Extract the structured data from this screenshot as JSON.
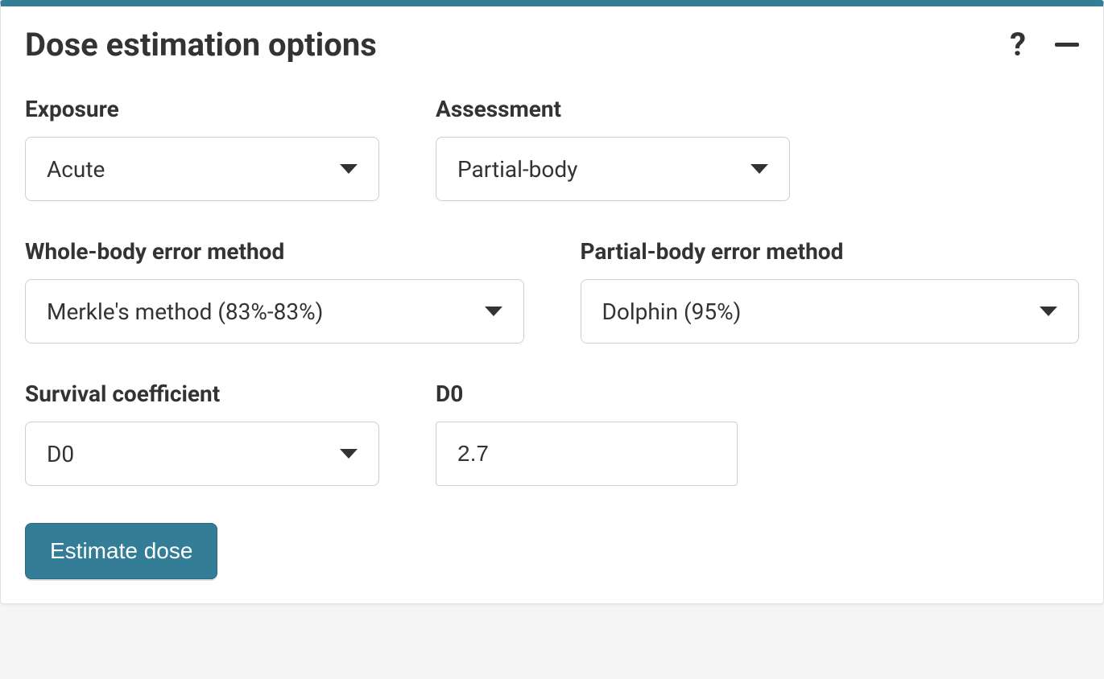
{
  "panel": {
    "title": "Dose estimation options"
  },
  "fields": {
    "exposure": {
      "label": "Exposure",
      "value": "Acute"
    },
    "assessment": {
      "label": "Assessment",
      "value": "Partial-body"
    },
    "whole_body_error": {
      "label": "Whole-body error method",
      "value": "Merkle's method (83%-83%)"
    },
    "partial_body_error": {
      "label": "Partial-body error method",
      "value": "Dolphin (95%)"
    },
    "survival_coeff": {
      "label": "Survival coefficient",
      "value": "D0"
    },
    "d0": {
      "label": "D0",
      "value": "2.7"
    }
  },
  "actions": {
    "estimate": "Estimate dose"
  }
}
